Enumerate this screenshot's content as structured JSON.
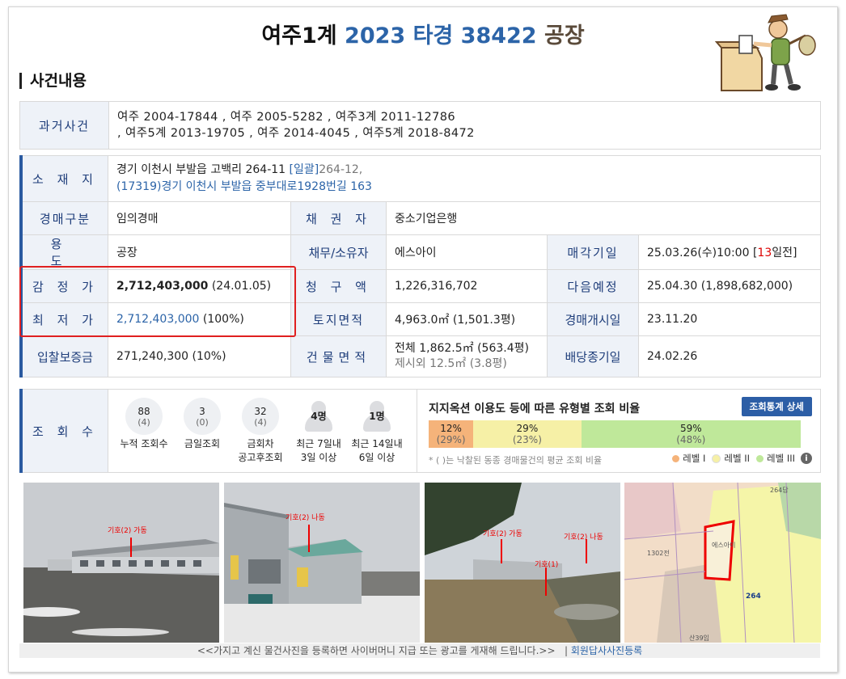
{
  "header": {
    "court": "여주1계",
    "case_no": "2023 타경 38422",
    "kind": "공장"
  },
  "section_title": "사건내용",
  "past_cases": {
    "label": "과거사건",
    "line1": "여주 2004-17844 , 여주 2005-5282 , 여주3계 2011-12786",
    "line2": ", 여주5계 2013-19705 , 여주 2014-4045 , 여주5계 2018-8472"
  },
  "details": {
    "location_label": "소 재 지",
    "location_main": "경기 이천시 부발읍 고백리 264-11",
    "location_bulk": "[일괄]",
    "location_extra": "264-12,",
    "location_road": "(17319)경기 이천시  부발읍 중부대로1928번길  163",
    "auction_type_label": "경매구분",
    "auction_type": "임의경매",
    "creditor_label": "채 권 자",
    "creditor": "중소기업은행",
    "usage_label": "용 도",
    "usage": "공장",
    "debtor_label": "채무/소유자",
    "debtor": "에스아이",
    "sale_date_label": "매각기일",
    "sale_date": "25.03.26(수)10:00 [",
    "sale_dday": "13",
    "sale_dday_suffix": "일전]",
    "appraisal_label": "감 정 가",
    "appraisal_value": "2,712,403,000",
    "appraisal_date": "(24.01.05)",
    "claim_label": "청 구 액",
    "claim": "1,226,316,702",
    "next_label": "다음예정",
    "next": "25.04.30 (1,898,682,000)",
    "min_label": "최 저 가",
    "min_value": "2,712,403,000",
    "min_pct": "(100%)",
    "land_label": "토지면적",
    "land": "4,963.0㎡ (1,501.3평)",
    "start_label": "경매개시일",
    "start": "23.11.20",
    "deposit_label": "입찰보증금",
    "deposit": "271,240,300 (10%)",
    "bldg_label": "건물면적",
    "bldg_total": "전체 1,862.5㎡ (563.4평)",
    "bldg_except": "제시외 12.5㎡ (3.8평)",
    "dividend_label": "배당종기일",
    "dividend": "24.02.26"
  },
  "views": {
    "label": "조 회 수",
    "stats": [
      {
        "value": "88",
        "sub": "(4)",
        "label": "누적 조회수",
        "label2": ""
      },
      {
        "value": "3",
        "sub": "(0)",
        "label": "금일조회",
        "label2": ""
      },
      {
        "value": "32",
        "sub": "(4)",
        "label": "금회차",
        "label2": "공고후조회"
      },
      {
        "value": "4명",
        "sub": "",
        "label": "최근 7일내",
        "label2": "3일 이상"
      },
      {
        "value": "1명",
        "sub": "",
        "label": "최근 14일내",
        "label2": "6일 이상"
      }
    ],
    "ratio_title": "지지옥션 이용도 등에 따른 유형별 조회 비율",
    "ratio_button": "조회통계 상세",
    "ratio": [
      {
        "pct": "12%",
        "avg": "(29%)",
        "color": "#f5b37a"
      },
      {
        "pct": "29%",
        "avg": "(23%)",
        "color": "#f6f0a6"
      },
      {
        "pct": "59%",
        "avg": "(48%)",
        "color": "#bfe89a"
      }
    ],
    "note": "* ( )는 낙찰된 동종 경매물건의 평균 조회 비율",
    "legend": [
      "레벨 I",
      "레벨 II",
      "레벨 III"
    ]
  },
  "photos": [
    {
      "tag": "기호(2) 가동"
    },
    {
      "tag": "기호(2) 나동"
    },
    {
      "tag1": "기호(2) 가동",
      "tag2": "기호(2) 나동",
      "tag3": "기호(1)"
    },
    {
      "map": "지적도"
    }
  ],
  "map_labels": {
    "owner": "에스아이",
    "lot": "264",
    "l1": "1302전",
    "l2": "산39임",
    "l3": "264답"
  },
  "caption": {
    "text": "<<가지고 계신 물건사진을 등록하면 사이버머니 지급 또는 광고를 게재해 드립니다.>>",
    "link": "회원답사사진등록"
  }
}
